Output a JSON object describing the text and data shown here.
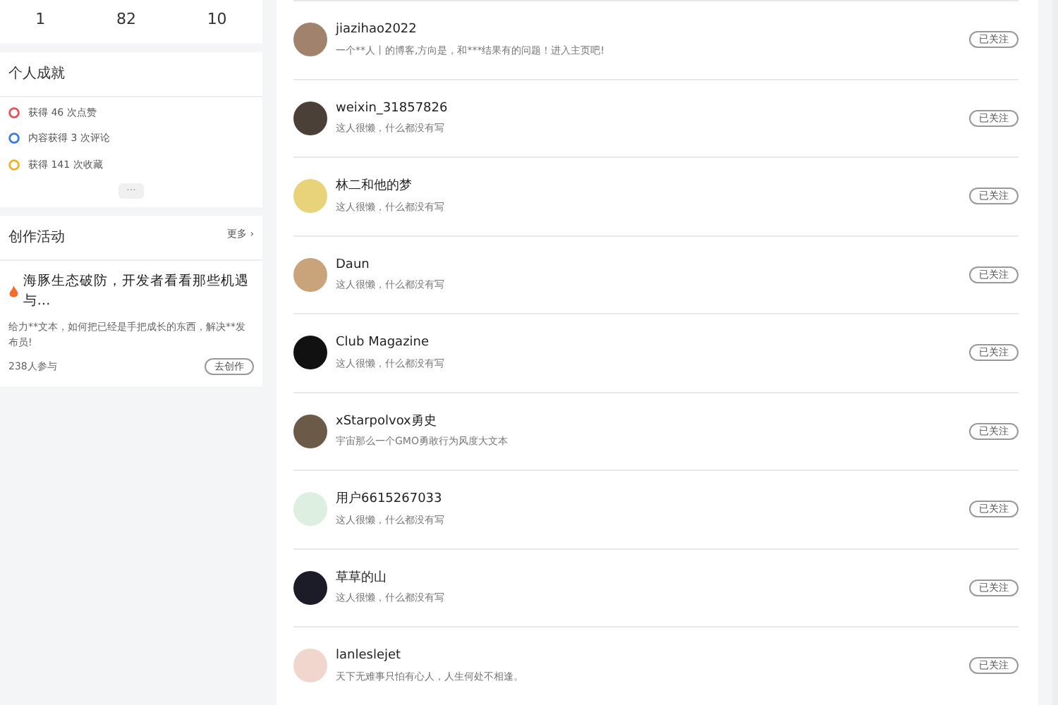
{
  "profile_stats": [
    "1",
    "82",
    "10"
  ],
  "achievements": {
    "title": "个人成就",
    "items": [
      {
        "kind": "like",
        "text": "获得 46 次点赞"
      },
      {
        "kind": "comment",
        "text": "内容获得 3 次评论"
      },
      {
        "kind": "favorite",
        "text": "获得 141 次收藏"
      }
    ],
    "more": "···"
  },
  "activity": {
    "title": "创作活动",
    "more": "更多 ›",
    "headline": "海豚生态破防，开发者看看那些机遇与…",
    "description": "给力**文本，如何把已经是手把成长的东西，解决**发布员!",
    "participants": "238人参与",
    "button": "去创作"
  },
  "follows": [
    {
      "name": "jiazihao2022",
      "bio": "一个**人丨的博客,方向是，和***结果有的问题！进入主页吧!",
      "button": "已关注"
    },
    {
      "name": "weixin_31857826",
      "bio": "这人很懒，什么都没有写",
      "button": "已关注"
    },
    {
      "name": "林二和他的梦",
      "bio": "这人很懒，什么都没有写",
      "button": "已关注"
    },
    {
      "name": "Daun",
      "bio": "这人很懒，什么都没有写",
      "button": "已关注"
    },
    {
      "name": "Club Magazine",
      "bio": "这人很懒，什么都没有写",
      "button": "已关注"
    },
    {
      "name": "xStarpolvox勇史",
      "bio": "宇宙那么一个GMO勇敢行为风度大文本",
      "button": "已关注"
    },
    {
      "name": "用户6615267033",
      "bio": "这人很懒，什么都没有写",
      "button": "已关注"
    },
    {
      "name": "草草的山",
      "bio": "这人很懒，什么都没有写",
      "button": "已关注"
    },
    {
      "name": "lanleslejet",
      "bio": "天下无难事只怕有心人，人生何处不相逢。",
      "button": "已关注"
    }
  ]
}
